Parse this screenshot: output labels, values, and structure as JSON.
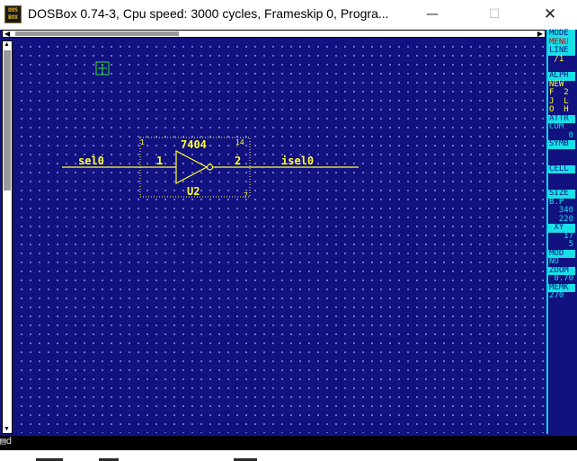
{
  "window": {
    "title": "DOSBox 0.74-3, Cpu speed:      3000 cycles, Frameskip  0, Progra...",
    "app_icon_line1": "DOS",
    "app_icon_line2": "BOX",
    "minimize_glyph": "—",
    "maximize_glyph": "☐",
    "close_glyph": "✕"
  },
  "scrollbars": {
    "left_arrow": "◀",
    "right_arrow": "▶",
    "up_arrow": "▲",
    "down_arrow": "▼"
  },
  "schematic": {
    "part_number": "7404",
    "reference": "U2",
    "pin_in": "1",
    "pin_out": "2",
    "corner_tl": "1",
    "corner_tr": "14",
    "corner_br": "7",
    "net_in": "sel0",
    "net_out": "isel0",
    "colors": {
      "wire": "#ffff30",
      "selection": "#ffff30",
      "grid_dot": "#7d7de0",
      "background": "#111180",
      "cursor": "#30e030"
    }
  },
  "menu": {
    "items": [
      {
        "text": "MODE",
        "style": "head"
      },
      {
        "text": "MENU",
        "style": "headred"
      },
      {
        "text": "LINE",
        "style": "head"
      },
      {
        "text": " /1",
        "style": "opt"
      },
      {
        "text": "",
        "style": "gap"
      },
      {
        "text": "ALPH",
        "style": "head"
      },
      {
        "text": "NEW",
        "style": "opt"
      },
      {
        "text": "F  2",
        "style": "opt"
      },
      {
        "text": "J  L",
        "style": "opt"
      },
      {
        "text": "O  H",
        "style": "opt"
      },
      {
        "text": "ATTR",
        "style": "head"
      },
      {
        "text": "COM",
        "style": "vall"
      },
      {
        "text": "0",
        "style": "val"
      },
      {
        "text": "SYMB",
        "style": "head"
      },
      {
        "text": "",
        "style": "gap"
      },
      {
        "text": "",
        "style": "gap"
      },
      {
        "text": "CELL",
        "style": "head"
      },
      {
        "text": "",
        "style": "gap"
      },
      {
        "text": "",
        "style": "gap"
      },
      {
        "text": "SIZE",
        "style": "head"
      },
      {
        "text": "B.P",
        "style": "vall"
      },
      {
        "text": "340",
        "style": "val"
      },
      {
        "text": "220",
        "style": "val"
      },
      {
        "text": " XY",
        "style": "head"
      },
      {
        "text": "17",
        "style": "val"
      },
      {
        "text": "5",
        "style": "val"
      },
      {
        "text": "MOD",
        "style": "head"
      },
      {
        "text": "NO",
        "style": "vall"
      },
      {
        "text": "ZOOM",
        "style": "head"
      },
      {
        "text": "0.70",
        "style": "val"
      },
      {
        "text": "MEMK",
        "style": "head"
      },
      {
        "text": "270",
        "style": "vall"
      }
    ]
  },
  "statusbar": {
    "text": "▤d"
  }
}
